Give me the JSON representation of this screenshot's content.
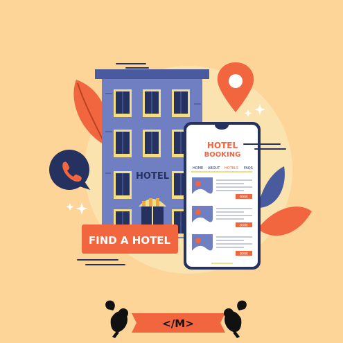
{
  "hotel_sign": "HOTEL",
  "button": {
    "label": "FIND A HOTEL"
  },
  "phone_app": {
    "title_line1": "HOTEL",
    "title_line2": "BOOKING",
    "nav": [
      "HOME",
      "ABOUT",
      "HOTELS",
      "FAQS"
    ],
    "card_button_label": "BOOK"
  },
  "watermark_text": "</M>",
  "colors": {
    "background": "#fdd598",
    "building": "#6f7fc2",
    "building_dark": "#4a5a9e",
    "accent_orange": "#f1653f",
    "navy": "#25315e",
    "window_frame": "#f3dd86"
  },
  "icons": [
    "phone-icon",
    "map-pin-icon",
    "sparkle-icon",
    "leaf-icon",
    "image-placeholder-icon"
  ]
}
